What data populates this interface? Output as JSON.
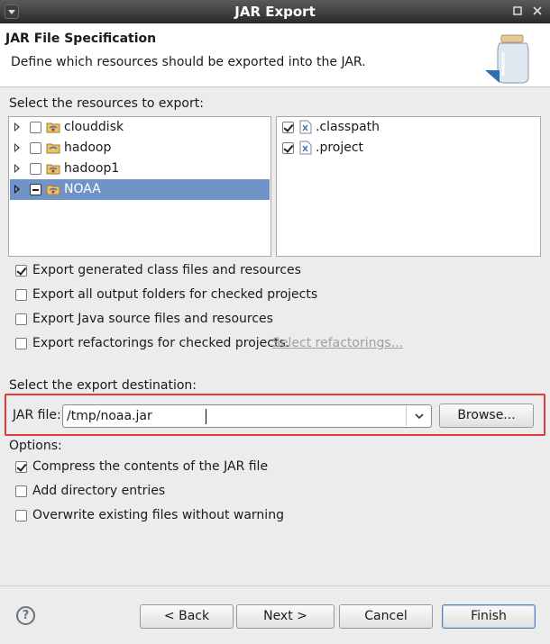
{
  "window": {
    "title": "JAR Export"
  },
  "header": {
    "title": "JAR File Specification",
    "description": "Define which resources should be exported into the JAR."
  },
  "resources": {
    "label": "Select the resources to export:",
    "projects": [
      {
        "name": "clouddisk",
        "state": "unchecked",
        "selected": false
      },
      {
        "name": "hadoop",
        "state": "unchecked",
        "selected": false
      },
      {
        "name": "hadoop1",
        "state": "unchecked",
        "selected": false
      },
      {
        "name": "NOAA",
        "state": "mixed",
        "selected": true
      }
    ],
    "files": [
      {
        "name": ".classpath",
        "checked": true
      },
      {
        "name": ".project",
        "checked": true
      }
    ]
  },
  "options_top": {
    "export_class_files": {
      "label": "Export generated class files and resources",
      "checked": true
    },
    "export_output_folders": {
      "label": "Export all output folders for checked projects",
      "checked": false
    },
    "export_source": {
      "label": "Export Java source files and resources",
      "checked": false
    },
    "export_refactorings": {
      "label": "Export refactorings for checked projects.",
      "checked": false
    },
    "select_refactorings_link": "Select refactorings..."
  },
  "destination": {
    "label": "Select the export destination:",
    "jar_file_label": "JAR file:",
    "jar_file_value": "/tmp/noaa.jar",
    "browse_label": "Browse..."
  },
  "options": {
    "label": "Options:",
    "compress": {
      "label": "Compress the contents of the JAR file",
      "checked": true
    },
    "add_directory": {
      "label": "Add directory entries",
      "checked": false
    },
    "overwrite": {
      "label": "Overwrite existing files without warning",
      "checked": false
    }
  },
  "buttons": {
    "help": "?",
    "back": "< Back",
    "next": "Next >",
    "cancel": "Cancel",
    "finish": "Finish"
  },
  "icons": {
    "window_menu": "chevron-down-icon",
    "minimize": "minimize-icon",
    "close": "close-icon",
    "banner": "jar-icon",
    "project": "java-project-icon",
    "file": "xml-file-icon",
    "help": "help-icon"
  },
  "colors": {
    "selection": "#7094c8",
    "highlight_border": "#e23b3b",
    "disabled_link": "#9aa0a8"
  }
}
